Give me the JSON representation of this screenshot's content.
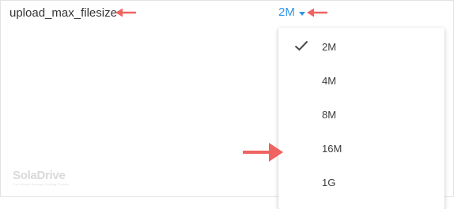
{
  "setting": {
    "name": "upload_max_filesize",
    "selected_value": "2M"
  },
  "dropdown": {
    "options": [
      {
        "label": "2M",
        "checked": true
      },
      {
        "label": "4M",
        "checked": false
      },
      {
        "label": "8M",
        "checked": false
      },
      {
        "label": "16M",
        "checked": false
      },
      {
        "label": "1G",
        "checked": false
      }
    ]
  },
  "watermark": {
    "brand": "SolaDrive",
    "tagline": "The Ultimate Managed Hosting Provider"
  },
  "colors": {
    "accent": "#2f96e8",
    "arrow": "#ef6461",
    "text": "#333333"
  }
}
